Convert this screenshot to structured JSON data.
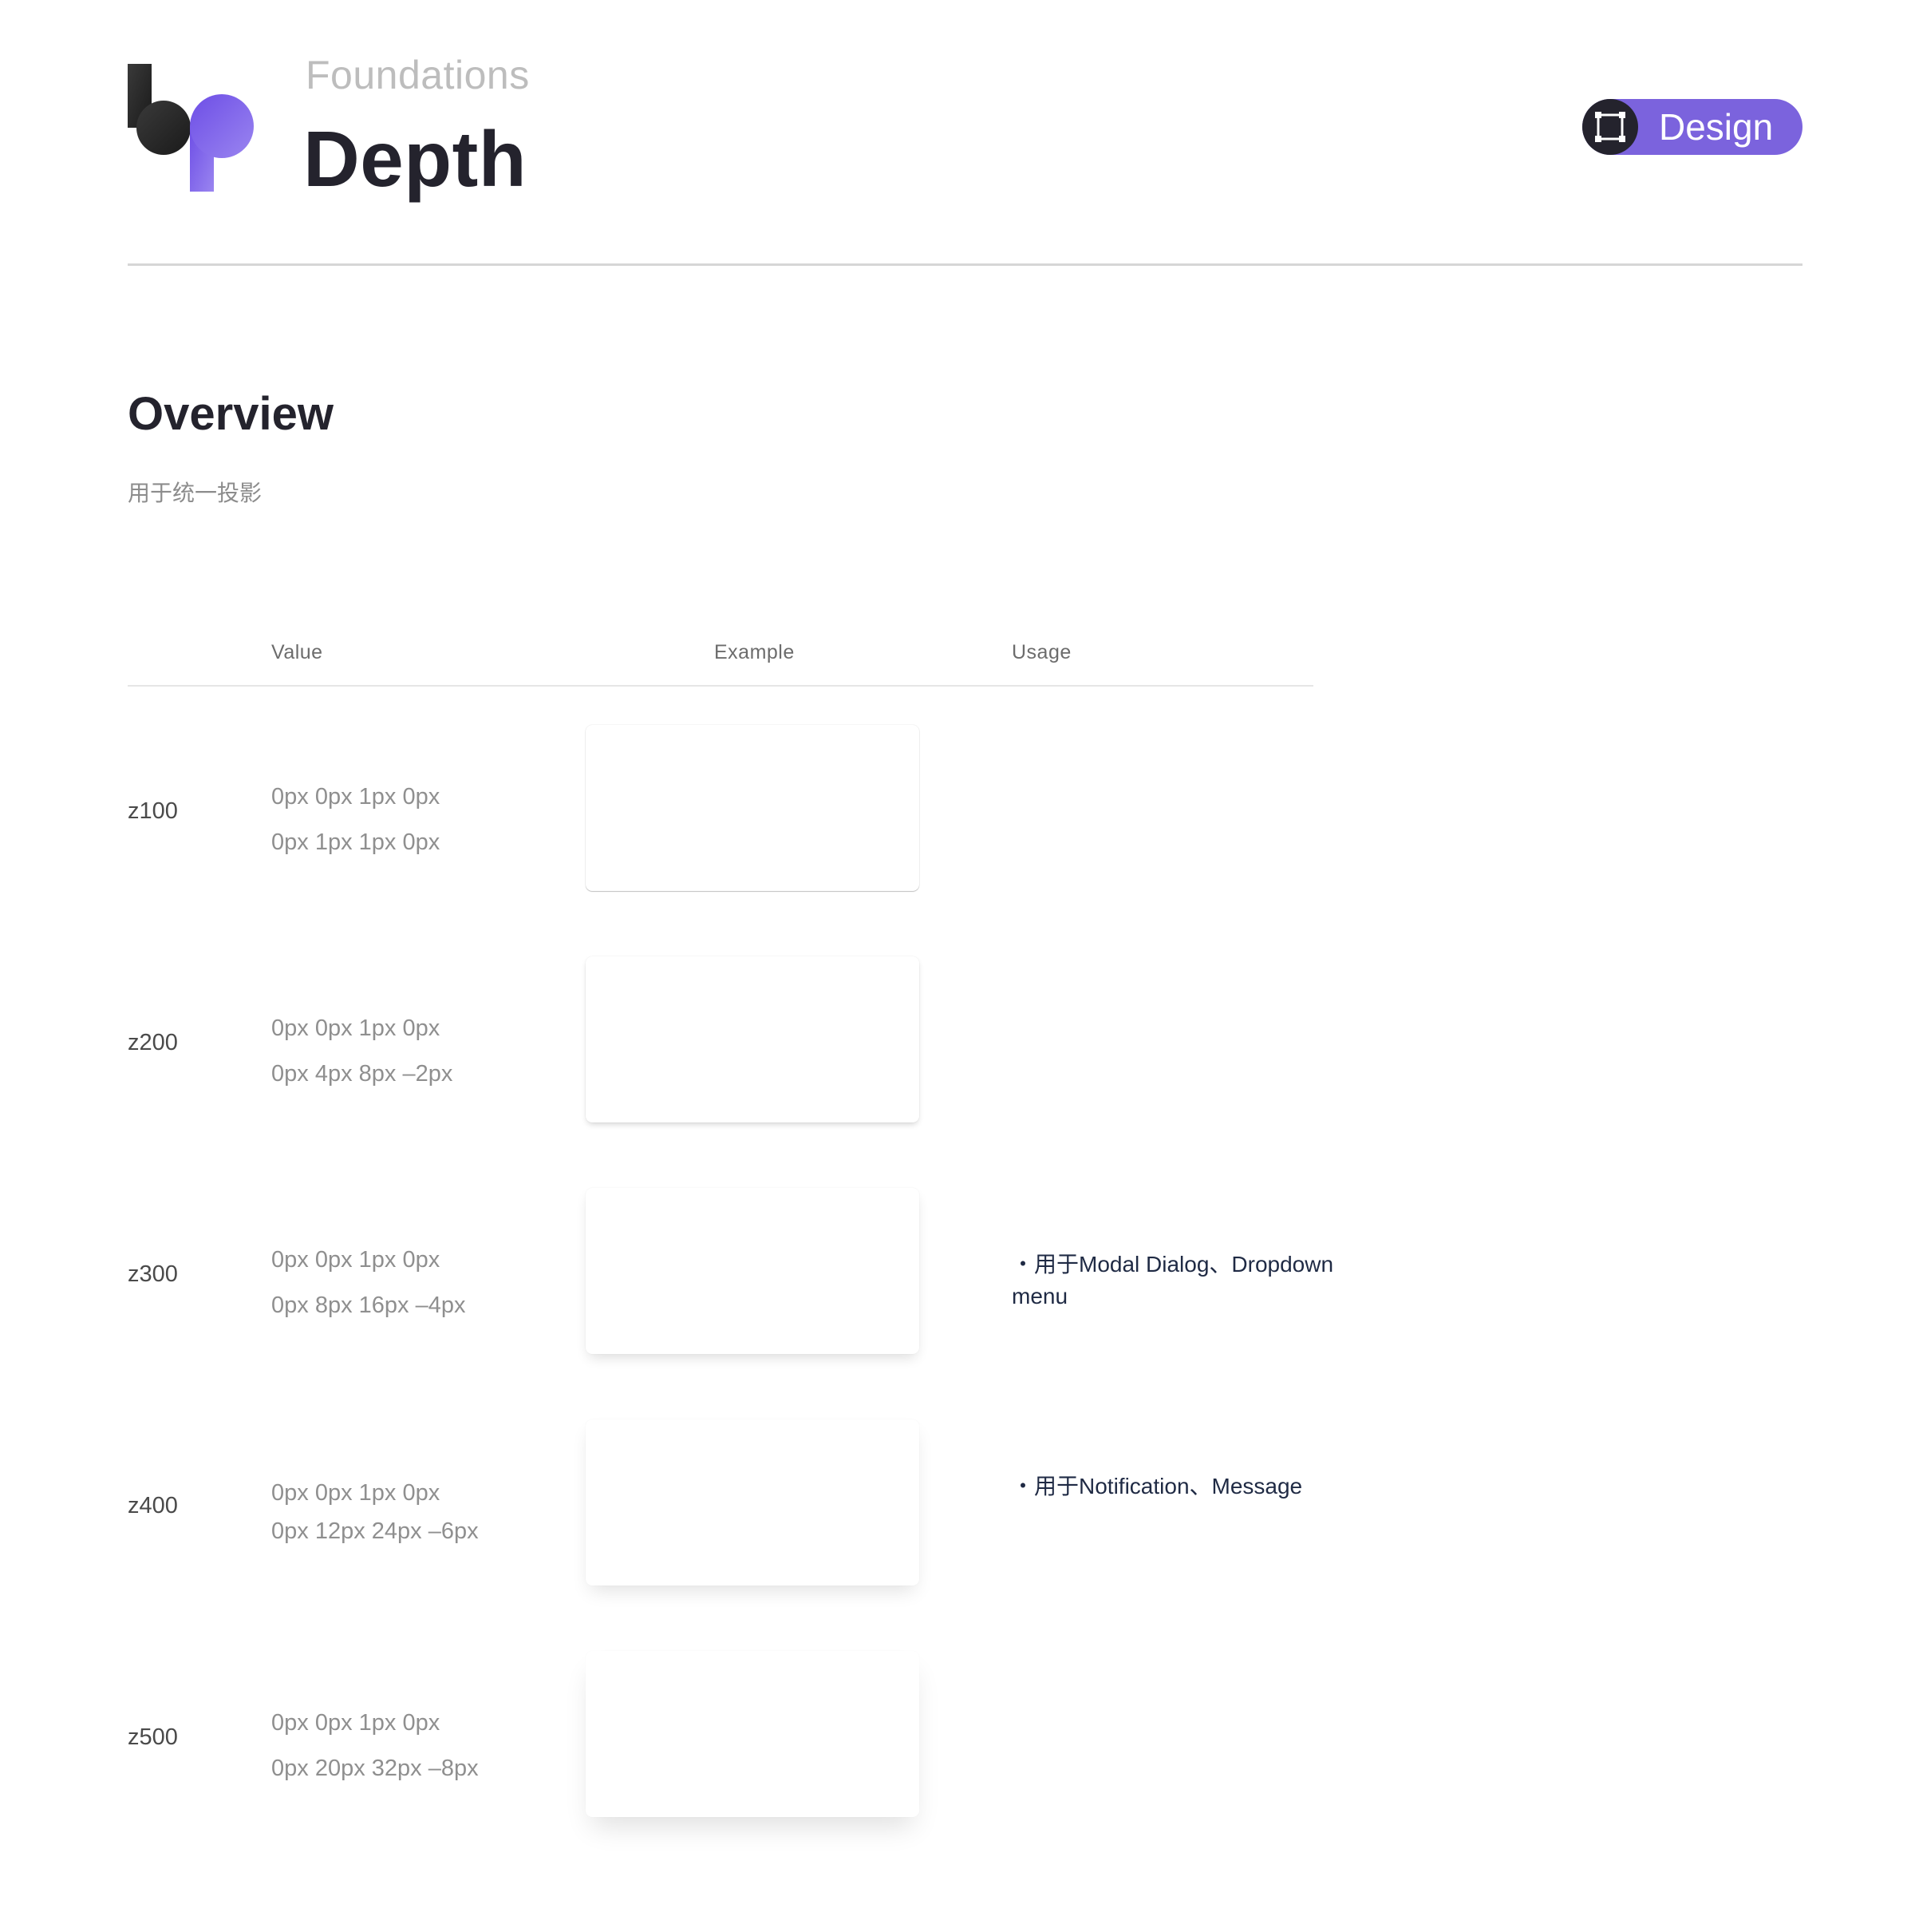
{
  "header": {
    "eyebrow": "Foundations",
    "title": "Depth",
    "badge_label": "Design",
    "colors": {
      "brand_purple": "#7b63dd",
      "dark": "#24232d"
    },
    "logo_icon": "brand-logo",
    "badge_icon": "frame-icon"
  },
  "overview": {
    "title": "Overview",
    "description": "用于统一投影"
  },
  "table": {
    "columns": {
      "value": "Value",
      "example": "Example",
      "usage": "Usage"
    },
    "rows": [
      {
        "name": "z100",
        "values": [
          "0px 0px 1px 0px",
          "0px 1px 1px 0px"
        ],
        "usage": ""
      },
      {
        "name": "z200",
        "values": [
          "0px 0px 1px 0px",
          "0px 4px 8px –2px"
        ],
        "usage": ""
      },
      {
        "name": "z300",
        "values": [
          "0px 0px 1px 0px",
          "0px 8px 16px –4px"
        ],
        "usage": "・用于Modal Dialog、Dropdown menu"
      },
      {
        "name": "z400",
        "values": [
          "0px 0px 1px 0px",
          "0px 12px 24px –6px"
        ],
        "usage": "・用于Notification、Message"
      },
      {
        "name": "z500",
        "values": [
          "0px 0px 1px 0px",
          "0px 20px 32px –8px"
        ],
        "usage": ""
      }
    ]
  }
}
